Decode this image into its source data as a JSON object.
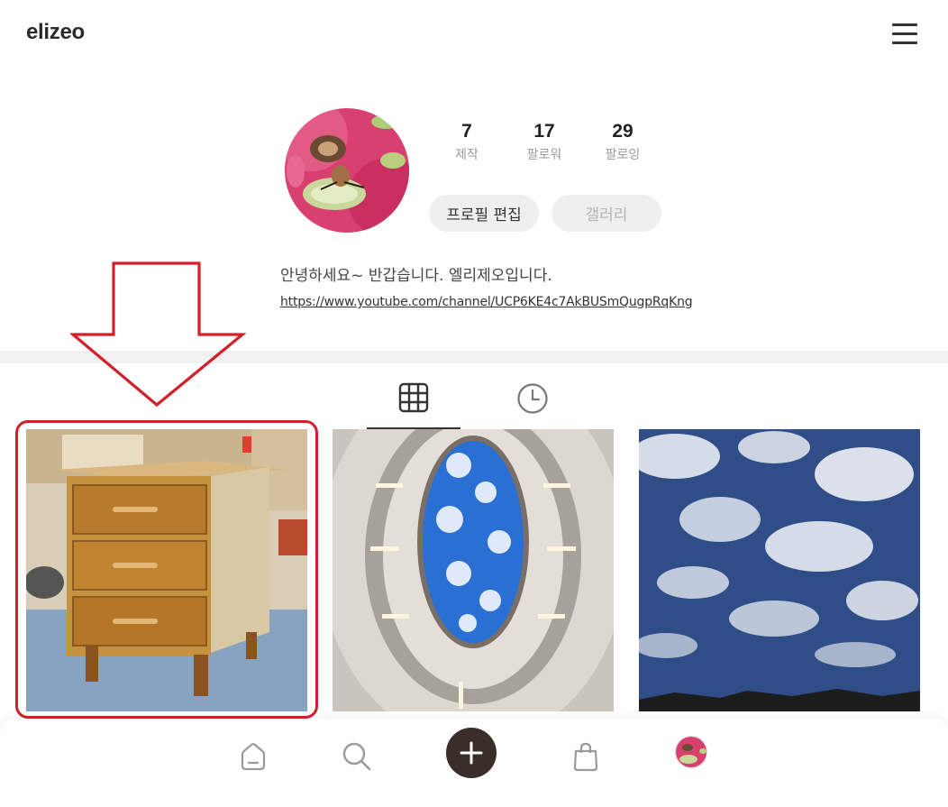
{
  "header": {
    "brand": "elizeo",
    "menu_icon": "hamburger-menu-icon"
  },
  "profile": {
    "stats": [
      {
        "value": "7",
        "label": "제작"
      },
      {
        "value": "17",
        "label": "팔로워"
      },
      {
        "value": "29",
        "label": "팔로잉"
      }
    ],
    "edit_button": "프로필 편집",
    "gallery_button": "갤러리",
    "bio": "안녕하세요~ 반갑습니다. 엘리제오입니다.",
    "link": "https://www.youtube.com/channel/UCP6KE4c7AkBUSmQugpRqKng"
  },
  "tabs": [
    {
      "icon": "grid-icon",
      "active": true
    },
    {
      "icon": "clock-icon",
      "active": false
    }
  ],
  "posts": [
    {
      "subject": "wooden-drawer-cabinet-photo",
      "highlighted": true
    },
    {
      "subject": "oval-sky-ceiling-photo",
      "highlighted": false
    },
    {
      "subject": "cloudy-blue-sky-photo",
      "highlighted": false
    }
  ],
  "annotation": {
    "color": "#d2202a"
  },
  "bottom_nav": [
    {
      "icon": "home-icon"
    },
    {
      "icon": "search-icon"
    },
    {
      "icon": "plus-icon"
    },
    {
      "icon": "shopping-bag-icon"
    },
    {
      "icon": "profile-avatar-icon"
    }
  ],
  "colors": {
    "accent_dark": "#3a2e2a",
    "pill_bg": "#efefef",
    "muted_text": "#9a9a9a"
  }
}
